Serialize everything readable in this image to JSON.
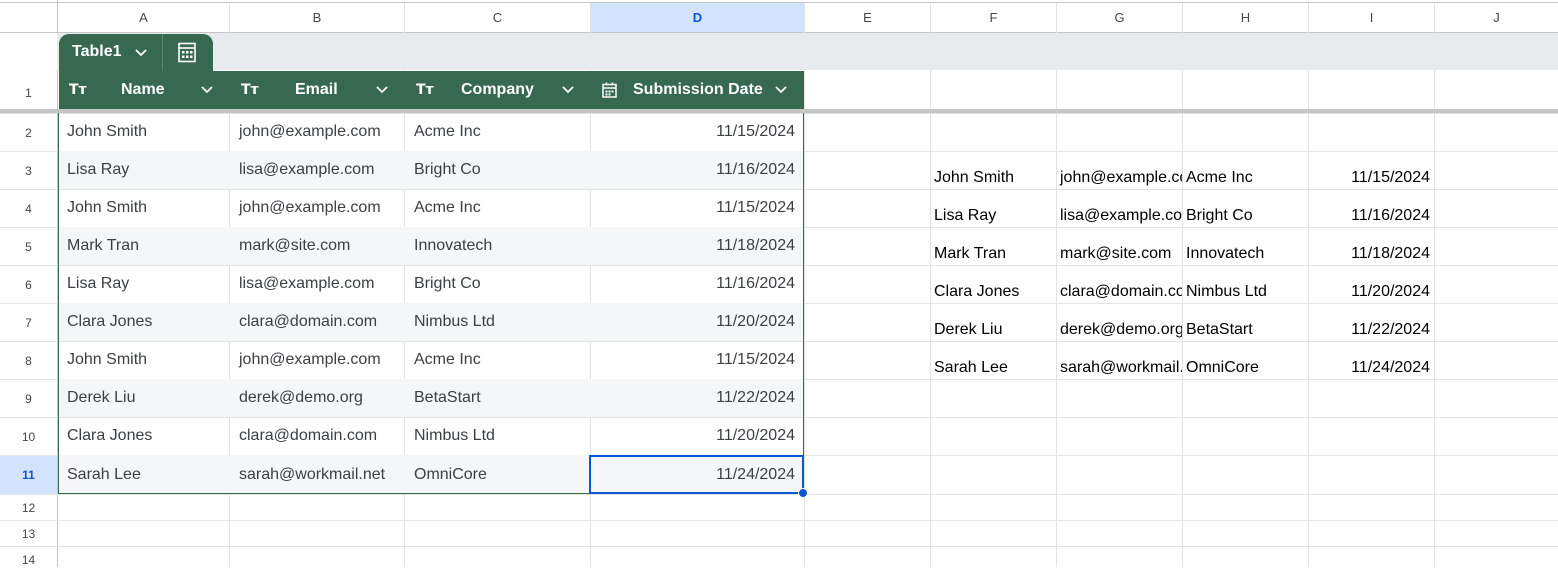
{
  "columns": [
    "A",
    "B",
    "C",
    "D",
    "E",
    "F",
    "G",
    "H",
    "I",
    "J"
  ],
  "selected_column": "D",
  "rows": [
    "1",
    "2",
    "3",
    "4",
    "5",
    "6",
    "7",
    "8",
    "9",
    "10",
    "11",
    "12",
    "13",
    "14"
  ],
  "selected_row": "11",
  "table": {
    "name": "Table1",
    "headers": [
      {
        "label": "Name",
        "type_icon": "text-type-icon"
      },
      {
        "label": "Email",
        "type_icon": "text-type-icon"
      },
      {
        "label": "Company",
        "type_icon": "text-type-icon"
      },
      {
        "label": "Submission Date",
        "type_icon": "calendar-icon"
      }
    ],
    "header_color": "#36694f",
    "band_color": "#f4f6f8",
    "rows": [
      [
        "John Smith",
        "john@example.com",
        "Acme Inc",
        "11/15/2024"
      ],
      [
        "Lisa Ray",
        "lisa@example.com",
        "Bright Co",
        "11/16/2024"
      ],
      [
        "John Smith",
        "john@example.com",
        "Acme Inc",
        "11/15/2024"
      ],
      [
        "Mark Tran",
        "mark@site.com",
        "Innovatech",
        "11/18/2024"
      ],
      [
        "Lisa Ray",
        "lisa@example.com",
        "Bright Co",
        "11/16/2024"
      ],
      [
        "Clara Jones",
        "clara@domain.com",
        "Nimbus Ltd",
        "11/20/2024"
      ],
      [
        "John Smith",
        "john@example.com",
        "Acme Inc",
        "11/15/2024"
      ],
      [
        "Derek Liu",
        "derek@demo.org",
        "BetaStart",
        "11/22/2024"
      ],
      [
        "Clara Jones",
        "clara@domain.com",
        "Nimbus Ltd",
        "11/20/2024"
      ],
      [
        "Sarah Lee",
        "sarah@workmail.net",
        "OmniCore",
        "11/24/2024"
      ]
    ]
  },
  "unique_results": [
    [
      "John Smith",
      "john@example.com",
      "Acme Inc",
      "11/15/2024"
    ],
    [
      "Lisa Ray",
      "lisa@example.com",
      "Bright Co",
      "11/16/2024"
    ],
    [
      "Mark Tran",
      "mark@site.com",
      "Innovatech",
      "11/18/2024"
    ],
    [
      "Clara Jones",
      "clara@domain.com",
      "Nimbus Ltd",
      "11/20/2024"
    ],
    [
      "Derek Liu",
      "derek@demo.org",
      "BetaStart",
      "11/22/2024"
    ],
    [
      "Sarah Lee",
      "sarah@workmail.net",
      "OmniCore",
      "11/24/2024"
    ]
  ],
  "selection_color": "#0b57d0"
}
